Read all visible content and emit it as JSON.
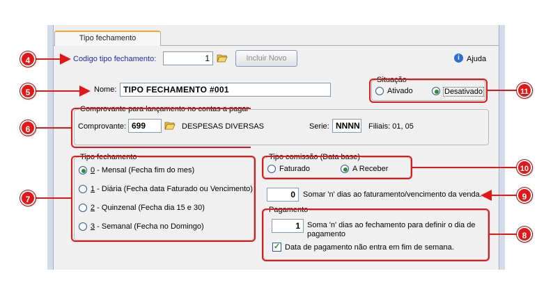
{
  "tab": {
    "label": "Tipo fechamento"
  },
  "codigo": {
    "label": "Codigo tipo fechamento:",
    "value": "1"
  },
  "incluir_novo": {
    "label": "Incluir Novo"
  },
  "ajuda": {
    "label": "Ajuda"
  },
  "nome": {
    "label": "Nome:",
    "value": "TIPO FECHAMENTO #001"
  },
  "situacao": {
    "legend": "Situação",
    "options": [
      {
        "label": "Ativado",
        "selected": false
      },
      {
        "label": "Desativado",
        "selected": true
      }
    ]
  },
  "comprovante_group": {
    "legend": "Comprovante para lançamento no contas a pagar",
    "comprovante_label": "Comprovante:",
    "comprovante_value": "699",
    "descricao": "DESPESAS DIVERSAS",
    "serie_label": "Serie:",
    "serie_value": "NNNN",
    "filiais": "Filiais: 01, 05"
  },
  "tipo_fechamento": {
    "legend": "Tipo fechamento",
    "options": [
      {
        "key": "0",
        "label": " - Mensal (Fecha fim do mes)",
        "selected": true
      },
      {
        "key": "1",
        "label": " - Diária (Fecha data Faturado ou Vencimento)",
        "selected": false
      },
      {
        "key": "2",
        "label": " - Quinzenal (Fecha dia 15 e 30)",
        "selected": false
      },
      {
        "key": "3",
        "label": " - Semanal (Fecha no Domingo)",
        "selected": false
      }
    ]
  },
  "tipo_comissao": {
    "legend": "Tipo comissão (Data base)",
    "options": [
      {
        "label": "Faturado",
        "selected": false
      },
      {
        "label": "A Receber",
        "selected": true
      }
    ]
  },
  "somar_dias": {
    "value": "0",
    "label": "Somar 'n' dias ao faturamento/vencimento da venda."
  },
  "pagamento": {
    "legend": "Pagamento",
    "dias_value": "1",
    "dias_label_line1": "Soma 'n' dias ao fechamento para definir o dia de",
    "dias_label_line2": "pagamento",
    "fim_semana_label": "Data de pagamento não entra em fim de semana.",
    "fim_semana_checked": true
  },
  "badges": [
    "4",
    "5",
    "6",
    "7",
    "8",
    "9",
    "10",
    "11"
  ],
  "colors": {
    "annotation": "#e21818",
    "label_blue": "#1c2ea8",
    "tab_accent": "#f2a33a"
  }
}
